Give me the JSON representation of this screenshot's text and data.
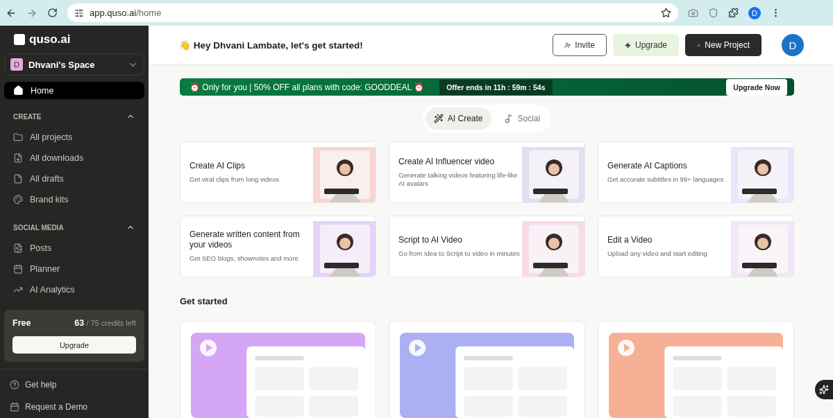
{
  "browser": {
    "url_host": "app.quso.ai",
    "url_path": "/home",
    "profile_initial": "D"
  },
  "sidebar": {
    "logo": "quso.ai",
    "workspace": {
      "initial": "D",
      "name": "Dhvani's Space"
    },
    "home": {
      "label": "Home",
      "selected": true
    },
    "sections": [
      {
        "title": "CREATE",
        "expanded": true,
        "items": [
          {
            "label": "All projects",
            "selected": false
          },
          {
            "label": "All downloads",
            "selected": false
          },
          {
            "label": "All drafts",
            "selected": false
          },
          {
            "label": "Brand kits",
            "selected": false
          }
        ]
      },
      {
        "title": "SOCIAL MEDIA",
        "expanded": true,
        "items": [
          {
            "label": "Posts",
            "selected": false
          },
          {
            "label": "Planner",
            "selected": false
          },
          {
            "label": "AI Analytics",
            "selected": false
          }
        ]
      }
    ],
    "plan": {
      "name": "Free",
      "credits_used": "63",
      "credits_rest": "/ 75 credits left",
      "button": "Upgrade"
    },
    "footer": [
      {
        "label": "Get help"
      },
      {
        "label": "Request a Demo"
      }
    ]
  },
  "header": {
    "greeting_emoji": "👋",
    "greeting": "Hey Dhvani Lambate, let's get started!",
    "invite": "Invite",
    "upgrade": "Upgrade",
    "new_project": "New Project",
    "avatar": "D"
  },
  "banner": {
    "text": "⏰ Only for you | 50% OFF all plans with code: GOODDEAL ⏰",
    "timer": "Offer ends in 11h : 59m : 54s",
    "button": "Upgrade Now"
  },
  "tabs": [
    {
      "label": "AI Create",
      "selected": true
    },
    {
      "label": "Social",
      "selected": false
    }
  ],
  "tools": [
    {
      "title": "Create AI Clips",
      "description": "Get viral clips from long videos"
    },
    {
      "title": "Create AI Influencer video",
      "description": "Generate talking videos featuring life-like AI avatars"
    },
    {
      "title": "Generate AI Captions",
      "description": "Get accurate subtitles in 99+ languages"
    },
    {
      "title": "Generate written content from your videos",
      "description": "Get SEO blogs, shownotes and more"
    },
    {
      "title": "Script to AI Video",
      "description": "Go from Idea to Script to video in minutes"
    },
    {
      "title": "Edit a Video",
      "description": "Upload any video and start editing"
    }
  ],
  "get_started": {
    "title": "Get started"
  }
}
